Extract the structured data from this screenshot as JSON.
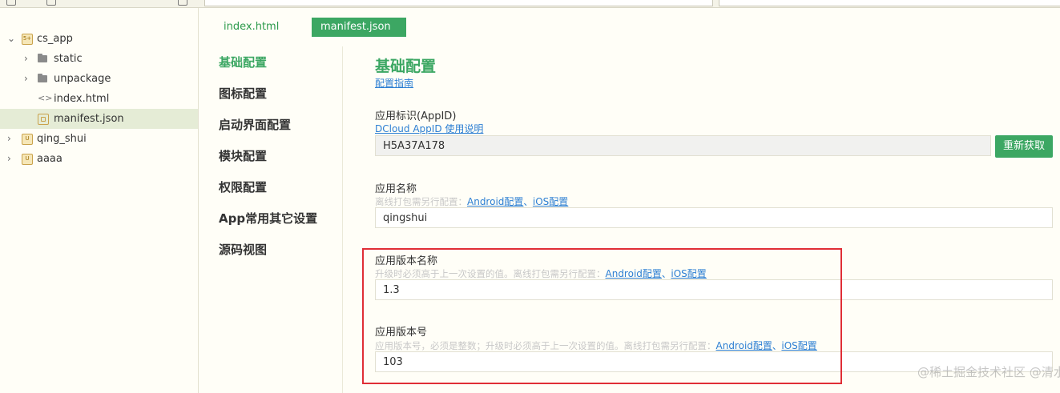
{
  "tree": {
    "project": "cs_app",
    "items": [
      {
        "label": "static",
        "type": "folder"
      },
      {
        "label": "unpackage",
        "type": "folder"
      },
      {
        "label": "index.html",
        "type": "html"
      },
      {
        "label": "manifest.json",
        "type": "json",
        "selected": true
      }
    ],
    "other_projects": [
      "qing_shui",
      "aaaa"
    ]
  },
  "tabs": [
    "index.html",
    "manifest.json"
  ],
  "manifest_nav": [
    {
      "label": "基础配置",
      "active": true
    },
    {
      "label": "图标配置"
    },
    {
      "label": "启动界面配置"
    },
    {
      "label": "模块配置"
    },
    {
      "label": "权限配置"
    },
    {
      "label": "App常用其它设置"
    },
    {
      "label": "源码视图"
    }
  ],
  "form": {
    "title": "基础配置",
    "guide_link": "配置指南",
    "appid": {
      "label": "应用标识(AppID)",
      "link": "DCloud AppID 使用说明",
      "value": "H5A37A178",
      "button": "重新获取"
    },
    "app_name": {
      "label": "应用名称",
      "hint": "离线打包需另行配置：",
      "android_link": "Android配置",
      "sep": "、",
      "ios_link": "iOS配置",
      "value": "qingshui"
    },
    "version_name": {
      "label": "应用版本名称",
      "hint": "升级时必须高于上一次设置的值。离线打包需另行配置：",
      "android_link": "Android配置",
      "sep": "、",
      "ios_link": "iOS配置",
      "value": "1.3"
    },
    "version_code": {
      "label": "应用版本号",
      "hint": "应用版本号，必须是整数；升级时必须高于上一次设置的值。离线打包需另行配置：",
      "android_link": "Android配置",
      "sep": "、",
      "ios_link": "iOS配置",
      "value": "103"
    }
  },
  "watermark": "@稀土掘金技术社区 @清水_qing",
  "colors": {
    "accent": "#3ca763",
    "link": "#2d7fd3",
    "highlight": "#e02e36",
    "background": "#fffef7",
    "selected_row": "#e5ecd6"
  }
}
